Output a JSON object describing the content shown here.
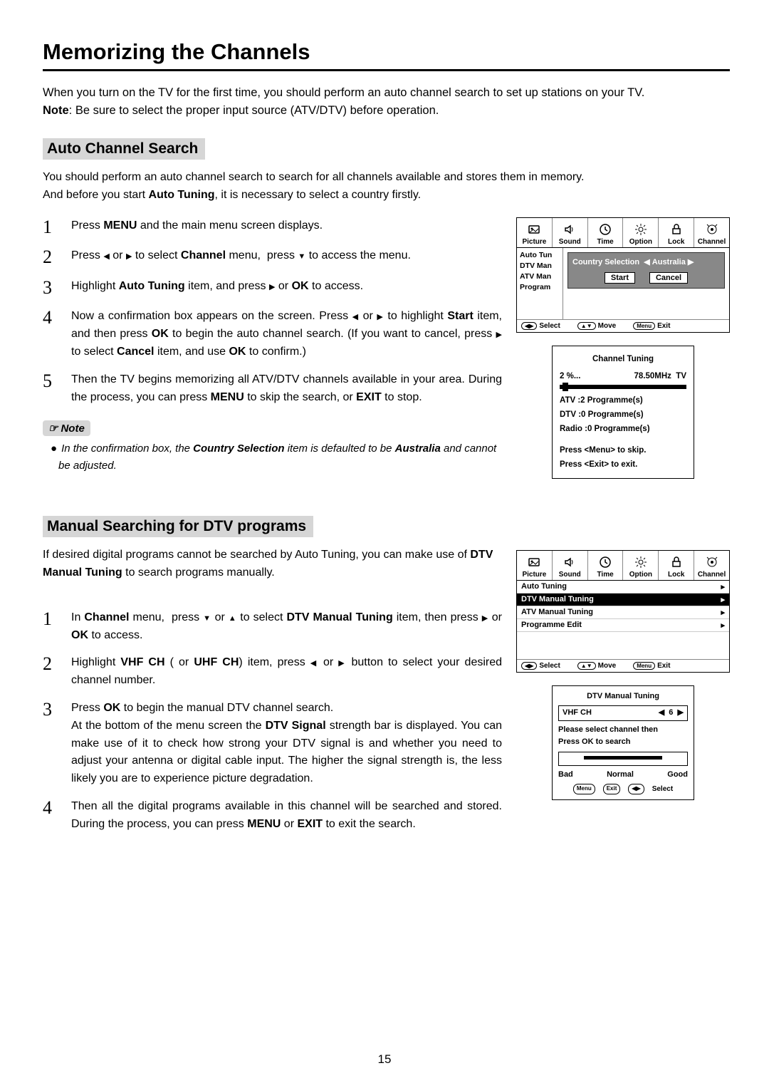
{
  "page": {
    "title": "Memorizing the Channels",
    "intro": "When you turn on the TV for the first time, you should perform an auto channel search to set up stations on your TV.",
    "intro_note_label": "Note",
    "intro_note_text": ": Be sure to select the proper input source (ATV/DTV) before operation.",
    "page_number": "15"
  },
  "section1": {
    "heading": "Auto Channel Search",
    "intro1": "You should perform an auto channel search to search for all channels available and stores them in memory.",
    "intro2_a": "And before you start ",
    "intro2_b": "Auto Tuning",
    "intro2_c": ", it is necessary to select a country firstly.",
    "steps": [
      {
        "n": "1",
        "html": "Press <b>MENU</b> and the main menu screen displays."
      },
      {
        "n": "2",
        "html": "Press <span class='tri'>◀</span> or <span class='tri'>▶</span> to select <b>Channel</b> menu, &nbsp;press <span class='tri'>▼</span> to access the menu."
      },
      {
        "n": "3",
        "html": "Highlight <b>Auto Tuning</b> item, and press <span class='tri'>▶</span> or <b>OK</b> to access."
      },
      {
        "n": "4",
        "html": "Now a confirmation box appears on the screen. Press <span class='tri'>◀</span> or <span class='tri'>▶</span> to highlight <b>Start</b> item, and then press <b>OK</b> to begin the auto channel search. (If you want to cancel, press <span class='tri'>▶</span> to select <b>Cancel</b> item, and use <b>OK</b> to confirm.)"
      },
      {
        "n": "5",
        "html": "Then the TV begins memorizing all ATV/DTV channels available in your area. During the process, you can press <b>MENU</b> to skip the search, or <b>EXIT</b> to stop."
      }
    ],
    "note_label": "Note",
    "note_text": "In the confirmation box, the <b>Country Selection</b> item is defaulted to be <b>Australia</b> and cannot be adjusted."
  },
  "section2": {
    "heading": "Manual Searching for DTV programs",
    "intro_html": "If desired digital programs cannot be searched by Auto Tuning, you can make use of <b>DTV Manual Tuning</b> to search programs manually.",
    "steps": [
      {
        "n": "1",
        "html": "In <b>Channel</b> menu, &nbsp;press <span class='tri'>▼</span> or <span class='tri'>▲</span> to select <b>DTV Manual Tuning</b> item, then press <span class='tri'>▶</span> or <b>OK</b> to access."
      },
      {
        "n": "2",
        "html": "Highlight <b>VHF CH</b> ( or <b>UHF CH</b>) item, press <span class='tri'>◀</span> or <span class='tri'>▶</span> button to select your desired channel number."
      },
      {
        "n": "3",
        "html": "Press <b>OK</b> to begin the manual DTV channel search.<br>At the bottom of the menu screen the <b>DTV Signal</b> strength bar is displayed. You can make use of it to check how strong your DTV signal is and whether you need to adjust your antenna or digital cable input. The higher the signal strength is, the less likely you are to experience picture degradation."
      },
      {
        "n": "4",
        "html": "Then all the digital programs available in this channel will be searched and stored. During the process, you can press <b>MENU</b> or <b>EXIT</b> to exit the search."
      }
    ]
  },
  "figs": {
    "tabs": [
      "Picture",
      "Sound",
      "Time",
      "Option",
      "Lock",
      "Channel"
    ],
    "side": [
      "Auto Tun",
      "DTV Man",
      "ATV Man",
      "Program"
    ],
    "popup_country_label": "Country Selection",
    "popup_country_val": "Australia",
    "popup_start": "Start",
    "popup_cancel": "Cancel",
    "hints_select": "Select",
    "hints_move": "Move",
    "hints_exit": "Exit",
    "hints_menu": "Menu",
    "tuning": {
      "title": "Channel  Tuning",
      "percent": "2  %...",
      "freq": "78.50MHz",
      "type": "TV",
      "atv_line": "ATV    :2    Programme(s)",
      "dtv_line": "DTV    :0    Programme(s)",
      "radio_line": "Radio  :0    Programme(s)",
      "skip": "Press <Menu> to skip.",
      "exit": "Press <Exit> to exit."
    },
    "menu2": [
      {
        "t": "Auto Tuning",
        "sel": false
      },
      {
        "t": "DTV Manual Tuning",
        "sel": true
      },
      {
        "t": "ATV Manual Tuning",
        "sel": false
      },
      {
        "t": "Programme Edit",
        "sel": false
      }
    ],
    "dtvbox": {
      "title": "DTV Manual Tuning",
      "row_label": "VHF  CH",
      "row_val": "6",
      "msg1": "Please select channel then",
      "msg2": "Press OK to search",
      "bad": "Bad",
      "normal": "Normal",
      "good": "Good"
    }
  }
}
